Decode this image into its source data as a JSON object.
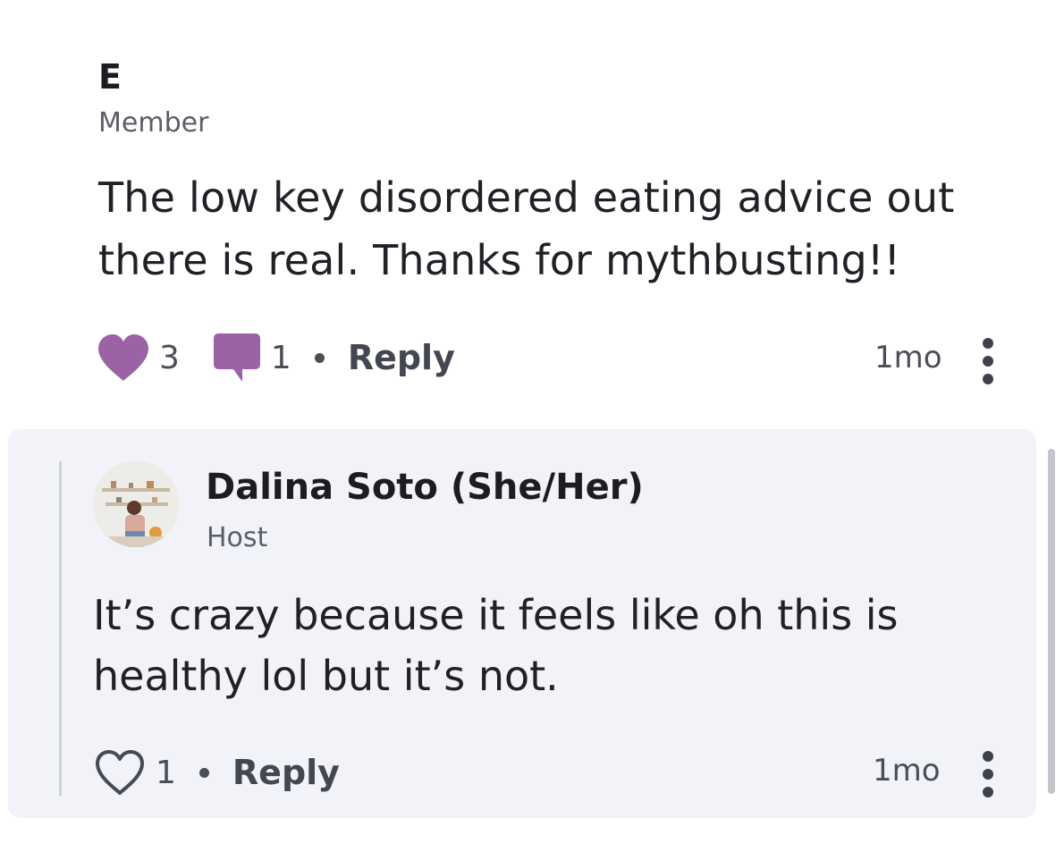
{
  "comment": {
    "author_initial": "E",
    "role": "Member",
    "body": "The low key disordered eating advice out there is real. Thanks for mythbusting!!",
    "likes": "3",
    "replies": "1",
    "reply_label": "Reply",
    "time": "1mo"
  },
  "reply": {
    "author": "Dalina Soto (She/Her)",
    "role": "Host",
    "body": "It’s crazy because it feels like oh this is healthy lol but it’s not.",
    "likes": "1",
    "reply_label": "Reply",
    "time": "1mo"
  },
  "colors": {
    "accent": "#9b62a6",
    "card_background": "#f2f3f8"
  },
  "icons": {
    "like_filled": "heart-icon",
    "like_outline": "heart-outline-icon",
    "comments": "speech-bubble-icon",
    "more": "kebab-menu-icon"
  }
}
